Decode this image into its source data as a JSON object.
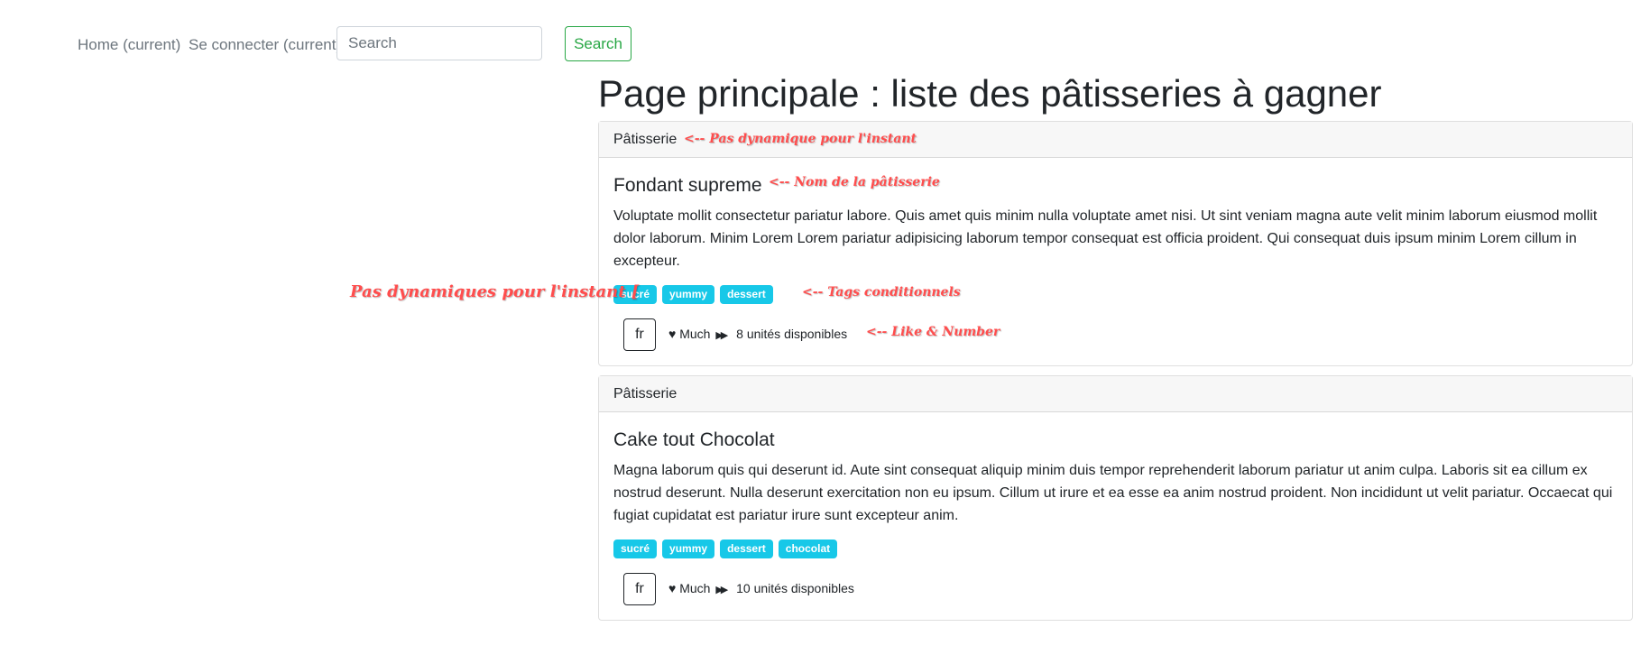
{
  "nav": {
    "home": "Home (current)",
    "login": "Se connecter (current)",
    "search_placeholder": "Search",
    "search_button": "Search"
  },
  "page_title": "Page principale : liste des pâtisseries à gagner",
  "cards": [
    {
      "header": "Pâtisserie",
      "title": "Fondant supreme",
      "text": "Voluptate mollit consectetur pariatur labore. Quis amet quis minim nulla voluptate amet nisi. Ut sint veniam magna aute velit minim laborum eiusmod mollit dolor laborum. Minim Lorem Lorem pariatur adipisicing laborum tempor consequat est officia proident. Qui consequat duis ipsum minim Lorem cillum in excepteur.",
      "tags": [
        "sucré",
        "yummy",
        "dessert"
      ],
      "lang": "fr",
      "likes": "Much",
      "units": "8 unités disponibles"
    },
    {
      "header": "Pâtisserie",
      "title": "Cake tout Chocolat",
      "text": "Magna laborum quis qui deserunt id. Aute sint consequat aliquip minim duis tempor reprehenderit laborum pariatur ut anim culpa. Laboris sit ea cillum ex nostrud deserunt. Nulla deserunt exercitation non eu ipsum. Cillum ut irure et ea esse ea anim nostrud proident. Non incididunt ut velit pariatur. Occaecat qui fugiat cupidatat est pariatur irure sunt excepteur anim.",
      "tags": [
        "sucré",
        "yummy",
        "dessert",
        "chocolat"
      ],
      "lang": "fr",
      "likes": "Much",
      "units": "10 unités disponibles"
    }
  ],
  "annotations": {
    "header_note": "<-- Pas dynamique pour l'instant",
    "title_note": "<-- Nom de la pâtisserie",
    "tags_note": "<-- Tags conditionnels",
    "like_note": "<-- Like & Number",
    "side_note": "Pas dynamiques pour l'instant ["
  },
  "colors": {
    "accent_green": "#28a745",
    "tag_cyan": "#17c8e8",
    "annotation_red": "#ff4d4d"
  }
}
